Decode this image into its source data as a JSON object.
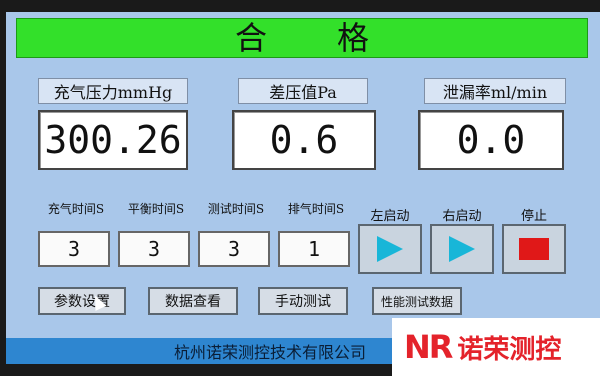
{
  "status": "合格",
  "readouts": [
    {
      "label": "充气压力mmHg",
      "value": "300.26"
    },
    {
      "label": "差压值Pa",
      "value": "0.6"
    },
    {
      "label": "泄漏率ml/min",
      "value": "0.0"
    }
  ],
  "timers": [
    {
      "label": "充气时间S",
      "value": "3"
    },
    {
      "label": "平衡时间S",
      "value": "3"
    },
    {
      "label": "测试时间S",
      "value": "3"
    },
    {
      "label": "排气时间S",
      "value": "1"
    }
  ],
  "controls": {
    "left_start_label": "左启动",
    "right_start_label": "右启动",
    "stop_label": "停止"
  },
  "buttons": {
    "params": "参数设置",
    "data_view": "数据查看",
    "manual_test": "手动测试",
    "perf_data": "性能测试数据"
  },
  "footer": "杭州诺荣测控技术有限公司",
  "logo": {
    "mark": "NR",
    "text": "诺荣测控"
  },
  "colors": {
    "status_green": "#33e02a",
    "screen_bg": "#a9c7ea",
    "play_cyan": "#18b6d8",
    "stop_red": "#e01818",
    "logo_red": "#e4232b"
  }
}
